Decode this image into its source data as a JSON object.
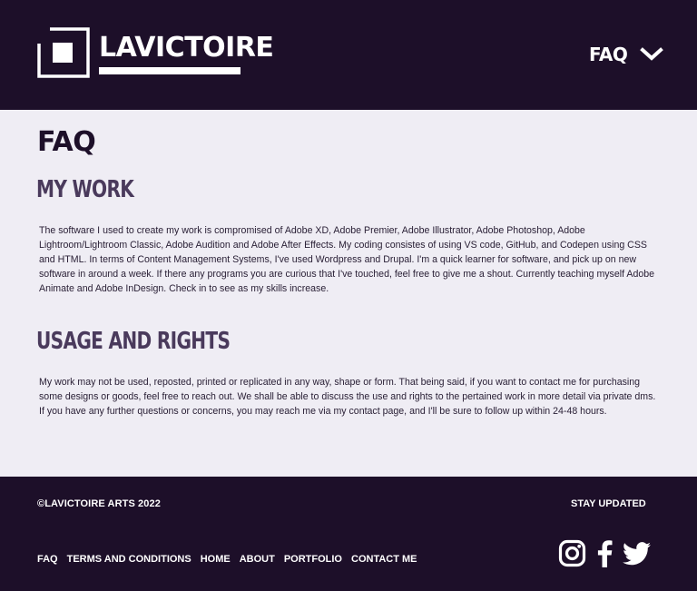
{
  "header": {
    "brand": "LAVICTOIRE",
    "nav_label": "FAQ"
  },
  "main": {
    "title": "FAQ",
    "sections": [
      {
        "heading": "MY WORK",
        "body": "The software I used to create my work is compromised of Adobe XD, Adobe Premier, Adobe Illustrator, Adobe Photoshop, Adobe Lightroom/Lightroom Classic, Adobe Audition and Adobe After Effects. My coding consistes of using VS code, GitHub, and Codepen using CSS and HTML. In terms of Content Management Systems, I've used Wordpress and Drupal. I'm a quick learner for software, and pick up on new software in around a week. If there any programs you are curious that I've touched, feel free to give me a shout. Currently teaching myself Adobe Animate and Adobe InDesign. Check in to see as my skills increase."
      },
      {
        "heading": "USAGE AND RIGHTS",
        "body": "My work may not be used, reposted, printed or replicated in any way, shape or form. That being said, if you want to contact me for purchasing some designs or goods, feel free to reach out. We shall be able to discuss the use and rights to the pertained work in more detail via private dms. If you have any further questions or concerns, you may reach me via my contact page, and I'll be sure to follow up within 24-48 hours."
      }
    ]
  },
  "footer": {
    "copyright": "©LAVICTOIRE ARTS 2022",
    "stay_updated": "STAY UPDATED",
    "links": [
      "FAQ",
      "TERMS AND CONDITIONS",
      "HOME",
      "ABOUT",
      "PORTFOLIO",
      "CONTACT ME"
    ],
    "social_icons": [
      "instagram-icon",
      "facebook-icon",
      "twitter-icon"
    ]
  },
  "colors": {
    "dark": "#1d0f29",
    "light": "#efedf4",
    "heading": "#4a3a5c"
  }
}
